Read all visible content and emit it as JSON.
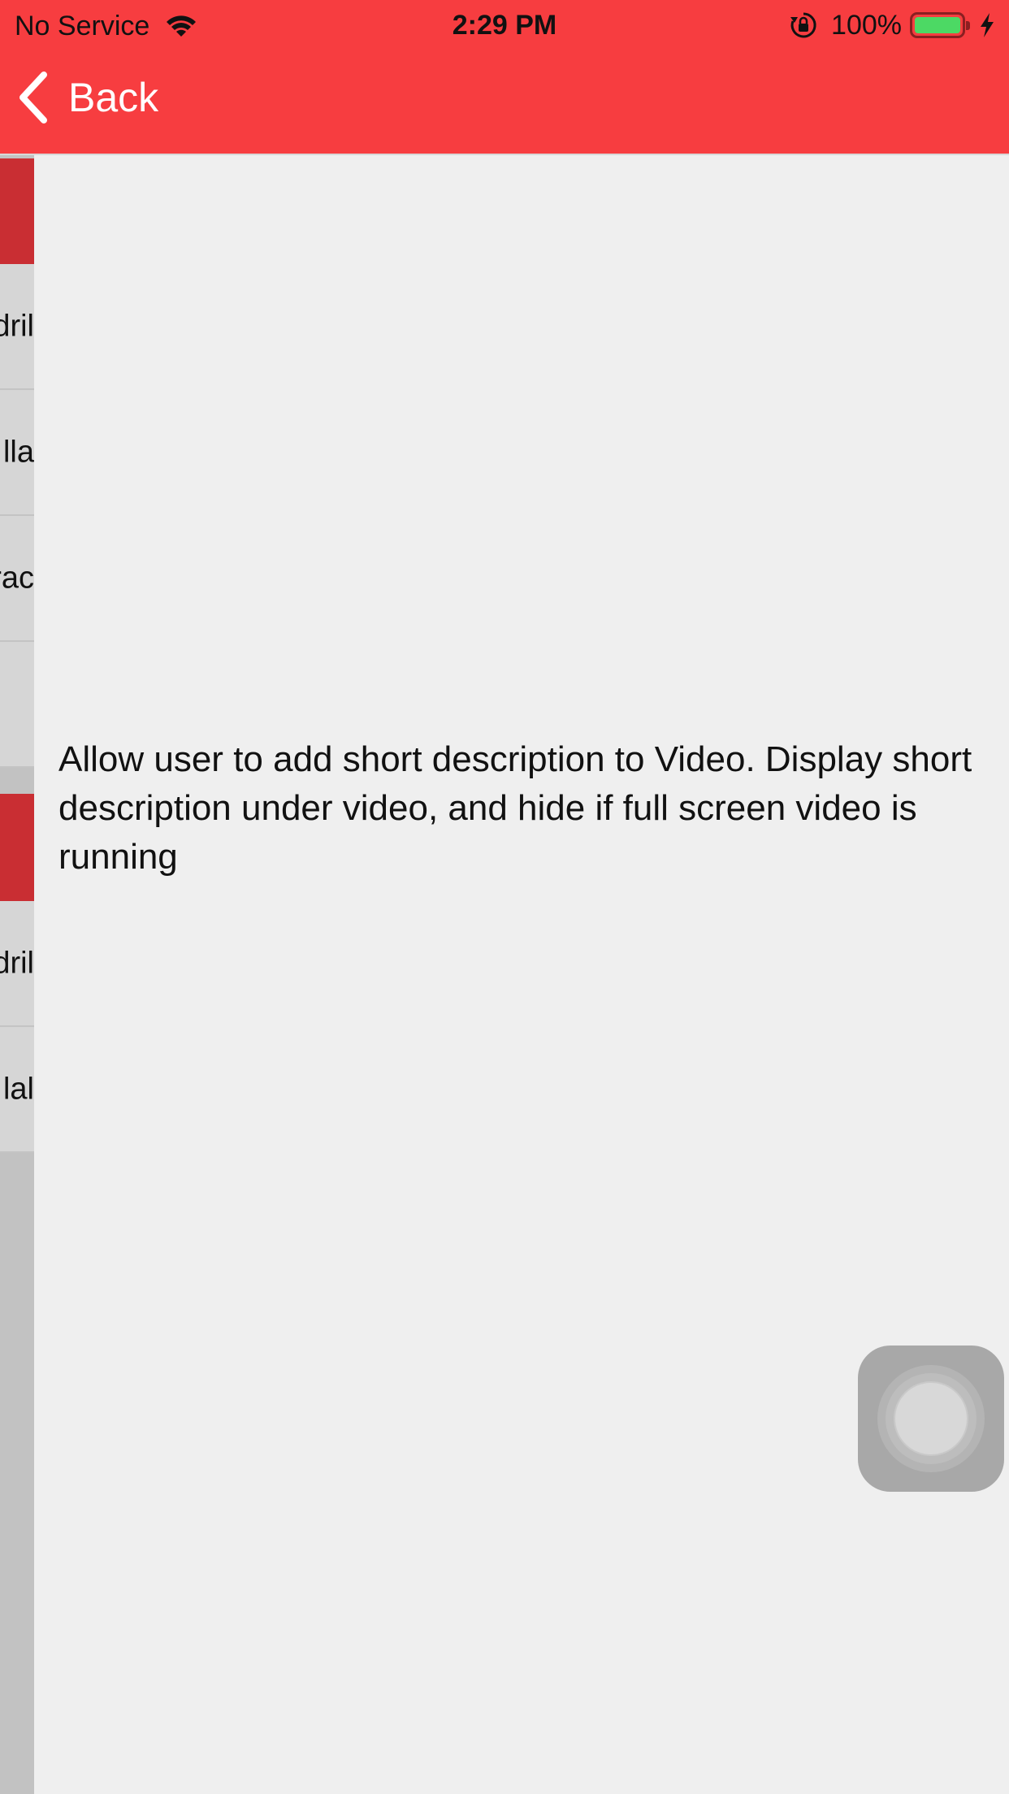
{
  "status_bar": {
    "carrier": "No Service",
    "time": "2:29 PM",
    "battery_percent": "100%",
    "battery_level": 1.0,
    "icons": [
      "wifi-icon",
      "rotation-lock-icon",
      "battery-icon",
      "charging-bolt-icon"
    ]
  },
  "nav": {
    "back_label": "Back",
    "back_icon": "chevron-left-icon"
  },
  "side_menu": {
    "items": [
      {
        "text": "dril"
      },
      {
        "text": "lla"
      },
      {
        "text": "rac"
      },
      {
        "text": ""
      },
      {
        "text": "dril"
      },
      {
        "text": "lal"
      }
    ]
  },
  "main": {
    "description": "Allow user to add short description to Video. Display short description under video, and hide if full screen video is running"
  },
  "colors": {
    "header": "#f73d40",
    "side_header": "#c92e33",
    "background": "#efefef",
    "battery_fill": "#4cd964"
  }
}
